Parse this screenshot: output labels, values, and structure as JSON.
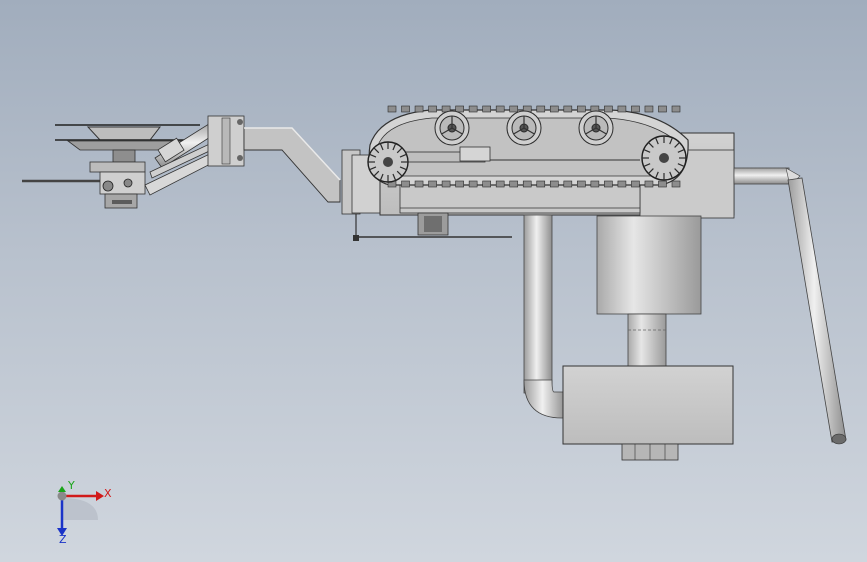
{
  "viewport": {
    "background_top": "#a1adbd",
    "background_bottom": "#d0d6de"
  },
  "model": {
    "metal_color": "#c8c8c8",
    "metal_dark": "#8e8e8e",
    "edge_color": "#2b2b2b",
    "pipe_highlight": "#eeeeee",
    "pipe_shadow": "#9c9c9c",
    "track_link_count": 22,
    "sprocket_count": 5,
    "roller_count": 3
  },
  "triad": {
    "x_label": "X",
    "y_label": "Y",
    "z_label": "Z",
    "x_color": "#d11a1a",
    "y_color": "#1aa51a",
    "z_color": "#1a33c8",
    "ball_color": "#8a8a8a"
  }
}
